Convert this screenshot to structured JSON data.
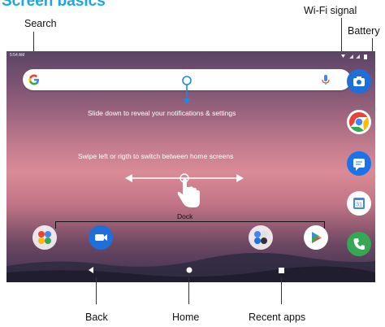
{
  "heading": "Screen basics",
  "callouts": {
    "search": "Search",
    "wifi": "Wi-Fi signal",
    "battery": "Battery",
    "back": "Back",
    "home": "Home",
    "recent": "Recent apps"
  },
  "status": {
    "time": "5:54 AM"
  },
  "hints": {
    "slide_down": "Slide down to reveal your notifications & settings",
    "swipe": "Swipe left or rigth to switch between home screens",
    "dock": "Dock"
  },
  "colors": {
    "heading": "#1aa6e6",
    "search_pin": "#1e88e5"
  }
}
